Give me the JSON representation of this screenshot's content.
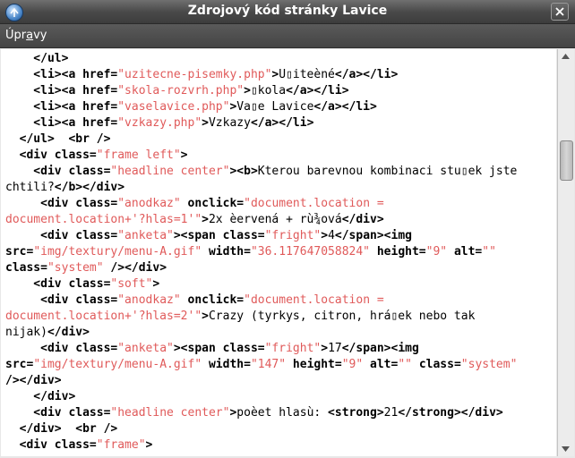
{
  "window": {
    "title": "Zdrojový kód stránky Lavice",
    "icons": {
      "app": "browser-globe-icon",
      "close": "close-icon"
    }
  },
  "menubar": {
    "items": [
      {
        "pre": "Úpr",
        "mnemonic": "a",
        "post": "vy"
      }
    ]
  },
  "source_lines": [
    [
      {
        "t": "t",
        "s": "    </ul>"
      }
    ],
    [
      {
        "t": "t",
        "s": "    <li><a href="
      },
      {
        "t": "v",
        "s": "\"uzitecne-pisemky.php\""
      },
      {
        "t": "t",
        "s": ">"
      },
      {
        "t": "x",
        "s": "U▯iteèné"
      },
      {
        "t": "t",
        "s": "</a></li>"
      }
    ],
    [
      {
        "t": "t",
        "s": "    <li><a href="
      },
      {
        "t": "v",
        "s": "\"skola-rozvrh.php\""
      },
      {
        "t": "t",
        "s": ">"
      },
      {
        "t": "x",
        "s": "▯kola"
      },
      {
        "t": "t",
        "s": "</a></li>"
      }
    ],
    [
      {
        "t": "t",
        "s": "    <li><a href="
      },
      {
        "t": "v",
        "s": "\"vaselavice.php\""
      },
      {
        "t": "t",
        "s": ">"
      },
      {
        "t": "x",
        "s": "Va▯e Lavice"
      },
      {
        "t": "t",
        "s": "</a></li>"
      }
    ],
    [
      {
        "t": "t",
        "s": "    <li><a href="
      },
      {
        "t": "v",
        "s": "\"vzkazy.php\""
      },
      {
        "t": "t",
        "s": ">"
      },
      {
        "t": "x",
        "s": "Vzkazy"
      },
      {
        "t": "t",
        "s": "</a></li>"
      }
    ],
    [
      {
        "t": "t",
        "s": "  </ul>  <br />"
      }
    ],
    [
      {
        "t": "t",
        "s": "  <div class="
      },
      {
        "t": "v",
        "s": "\"frame left\""
      },
      {
        "t": "t",
        "s": ">"
      }
    ],
    [
      {
        "t": "t",
        "s": "    <div class="
      },
      {
        "t": "v",
        "s": "\"headline center\""
      },
      {
        "t": "t",
        "s": "><b>"
      },
      {
        "t": "x",
        "s": "Kterou barevnou kombinaci stu▯ek jste"
      }
    ],
    [
      {
        "t": "x",
        "s": "chtili?"
      },
      {
        "t": "t",
        "s": "</b></div>"
      }
    ],
    [
      {
        "t": "t",
        "s": "     <div class="
      },
      {
        "t": "v",
        "s": "\"anodkaz\""
      },
      {
        "t": "t",
        "s": " onclick="
      },
      {
        "t": "v",
        "s": "\"document.location ="
      }
    ],
    [
      {
        "t": "v",
        "s": "document.location+'?hlas=1'\""
      },
      {
        "t": "t",
        "s": ">"
      },
      {
        "t": "x",
        "s": "2x èervená + rù¾ová"
      },
      {
        "t": "t",
        "s": "</div>"
      }
    ],
    [
      {
        "t": "t",
        "s": "     <div class="
      },
      {
        "t": "v",
        "s": "\"anketa\""
      },
      {
        "t": "t",
        "s": "><span class="
      },
      {
        "t": "v",
        "s": "\"fright\""
      },
      {
        "t": "t",
        "s": ">"
      },
      {
        "t": "x",
        "s": "4"
      },
      {
        "t": "t",
        "s": "</span><img"
      }
    ],
    [
      {
        "t": "t",
        "s": "src="
      },
      {
        "t": "v",
        "s": "\"img/textury/menu-A.gif\""
      },
      {
        "t": "t",
        "s": " width="
      },
      {
        "t": "v",
        "s": "\"36.117647058824\""
      },
      {
        "t": "t",
        "s": " height="
      },
      {
        "t": "v",
        "s": "\"9\""
      },
      {
        "t": "t",
        "s": " alt="
      },
      {
        "t": "v",
        "s": "\"\""
      }
    ],
    [
      {
        "t": "t",
        "s": "class="
      },
      {
        "t": "v",
        "s": "\"system\""
      },
      {
        "t": "t",
        "s": " /></div>"
      }
    ],
    [
      {
        "t": "t",
        "s": "    <div class="
      },
      {
        "t": "v",
        "s": "\"soft\""
      },
      {
        "t": "t",
        "s": ">"
      }
    ],
    [
      {
        "t": "t",
        "s": "     <div class="
      },
      {
        "t": "v",
        "s": "\"anodkaz\""
      },
      {
        "t": "t",
        "s": " onclick="
      },
      {
        "t": "v",
        "s": "\"document.location ="
      }
    ],
    [
      {
        "t": "v",
        "s": "document.location+'?hlas=2'\""
      },
      {
        "t": "t",
        "s": ">"
      },
      {
        "t": "x",
        "s": "Crazy (tyrkys, citron, hrá▯ek nebo tak"
      }
    ],
    [
      {
        "t": "x",
        "s": "nijak)"
      },
      {
        "t": "t",
        "s": "</div>"
      }
    ],
    [
      {
        "t": "t",
        "s": "     <div class="
      },
      {
        "t": "v",
        "s": "\"anketa\""
      },
      {
        "t": "t",
        "s": "><span class="
      },
      {
        "t": "v",
        "s": "\"fright\""
      },
      {
        "t": "t",
        "s": ">"
      },
      {
        "t": "x",
        "s": "17"
      },
      {
        "t": "t",
        "s": "</span><img"
      }
    ],
    [
      {
        "t": "t",
        "s": "src="
      },
      {
        "t": "v",
        "s": "\"img/textury/menu-A.gif\""
      },
      {
        "t": "t",
        "s": " width="
      },
      {
        "t": "v",
        "s": "\"147\""
      },
      {
        "t": "t",
        "s": " height="
      },
      {
        "t": "v",
        "s": "\"9\""
      },
      {
        "t": "t",
        "s": " alt="
      },
      {
        "t": "v",
        "s": "\"\""
      },
      {
        "t": "t",
        "s": " class="
      },
      {
        "t": "v",
        "s": "\"system\""
      }
    ],
    [
      {
        "t": "t",
        "s": "/></div>"
      }
    ],
    [
      {
        "t": "t",
        "s": "    </div>"
      }
    ],
    [
      {
        "t": "t",
        "s": "    <div class="
      },
      {
        "t": "v",
        "s": "\"headline center\""
      },
      {
        "t": "t",
        "s": ">"
      },
      {
        "t": "x",
        "s": "poèet hlasù: "
      },
      {
        "t": "t",
        "s": "<strong>"
      },
      {
        "t": "x",
        "s": "21"
      },
      {
        "t": "t",
        "s": "</strong></div>"
      }
    ],
    [
      {
        "t": "t",
        "s": "  </div>  <br />"
      }
    ],
    [
      {
        "t": "t",
        "s": "  <div class="
      },
      {
        "t": "v",
        "s": "\"frame\""
      },
      {
        "t": "t",
        "s": ">"
      }
    ]
  ]
}
